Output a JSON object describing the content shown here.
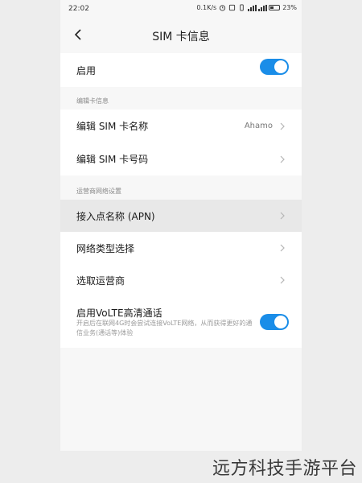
{
  "status_bar": {
    "time": "22:02",
    "speed": "0.1K/s",
    "battery": "23%"
  },
  "header": {
    "title": "SIM 卡信息"
  },
  "enable_row": {
    "label": "启用",
    "enabled": true
  },
  "section_edit": {
    "header": "编辑卡信息",
    "items": [
      {
        "label": "编辑 SIM 卡名称",
        "value": "Ahamo"
      },
      {
        "label": "编辑 SIM 卡号码",
        "value": ""
      }
    ]
  },
  "section_carrier": {
    "header": "运营商网络设置",
    "items": [
      {
        "label": "接入点名称 (APN)"
      },
      {
        "label": "网络类型选择"
      },
      {
        "label": "选取运营商"
      }
    ]
  },
  "volte": {
    "title": "启用VoLTE高清通话",
    "description": "开启后在联网4G时会尝试连接VoLTE网络，从而获得更好的通信业务(通话等)体验",
    "enabled": true
  },
  "watermark": "远方科技手游平台",
  "colors": {
    "accent": "#1a8de8",
    "background": "#f7f7f7",
    "card": "#ffffff",
    "highlight": "#e8e8e8"
  },
  "icons": {
    "back": "chevron-left-icon",
    "row_arrow": "chevron-right-icon"
  }
}
